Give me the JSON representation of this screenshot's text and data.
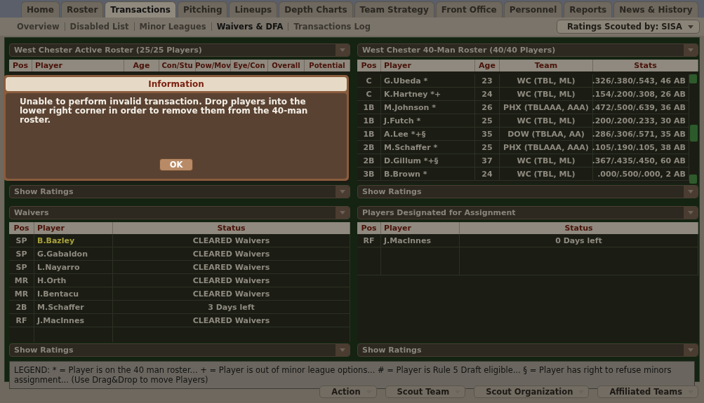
{
  "tabs": [
    {
      "label": "Home",
      "selected": false
    },
    {
      "label": "Roster",
      "selected": false
    },
    {
      "label": "Transactions",
      "selected": true
    },
    {
      "label": "Pitching",
      "selected": false
    },
    {
      "label": "Lineups",
      "selected": false
    },
    {
      "label": "Depth Charts",
      "selected": false
    },
    {
      "label": "Team Strategy",
      "selected": false
    },
    {
      "label": "Front Office",
      "selected": false
    },
    {
      "label": "Personnel",
      "selected": false
    },
    {
      "label": "Reports",
      "selected": false
    },
    {
      "label": "News & History",
      "selected": false
    }
  ],
  "subnav": [
    {
      "label": "Overview",
      "selected": false
    },
    {
      "label": "Disabled List",
      "selected": false
    },
    {
      "label": "Minor Leagues",
      "selected": false
    },
    {
      "label": "Waivers & DFA",
      "selected": true
    },
    {
      "label": "Transactions Log",
      "selected": false
    }
  ],
  "scouted_button": "Ratings Scouted by: SISA",
  "active_roster": {
    "title": "West Chester Active Roster (25/25 Players)",
    "columns": [
      "Pos",
      "Player",
      "Age",
      "Con/Stu",
      "Pow/Mov",
      "Eye/Con",
      "Overall",
      "Potential"
    ],
    "footer": "Show Ratings"
  },
  "forty_man_roster": {
    "title": "West Chester 40-Man Roster (40/40 Players)",
    "columns": [
      "Pos",
      "Player",
      "Age",
      "Team",
      "Stats"
    ],
    "footer": "Show Ratings",
    "rows": [
      {
        "pos": "C",
        "player": "G.Ubeda *",
        "age": "23",
        "team": "WC (TBL, ML)",
        "stats": ".326/.380/.543, 46 AB"
      },
      {
        "pos": "C",
        "player": "K.Hartney *+",
        "age": "24",
        "team": "WC (TBL, ML)",
        "stats": ".154/.200/.308, 26 AB"
      },
      {
        "pos": "1B",
        "player": "M.Johnson *",
        "age": "26",
        "team": "PHX (TBLAAA, AAA)",
        "stats": ".472/.500/.639, 36 AB"
      },
      {
        "pos": "1B",
        "player": "J.Futch *",
        "age": "25",
        "team": "WC (TBL, ML)",
        "stats": ".200/.200/.233, 30 AB"
      },
      {
        "pos": "1B",
        "player": "A.Lee *+§",
        "age": "35",
        "team": "DOW (TBLAA, AA)",
        "stats": ".286/.306/.571, 35 AB"
      },
      {
        "pos": "2B",
        "player": "M.Schaffer *",
        "age": "25",
        "team": "PHX (TBLAAA, AAA)",
        "stats": ".105/.190/.105, 38 AB"
      },
      {
        "pos": "2B",
        "player": "D.Gillum *+§",
        "age": "37",
        "team": "WC (TBL, ML)",
        "stats": ".367/.435/.450, 60 AB"
      },
      {
        "pos": "3B",
        "player": "B.Brown *",
        "age": "24",
        "team": "WC (TBL, ML)",
        "stats": ".000/.500/.000, 2 AB"
      }
    ]
  },
  "waivers": {
    "title": "Waivers",
    "columns": [
      "Pos",
      "Player",
      "Status"
    ],
    "footer": "Show Ratings",
    "rows": [
      {
        "pos": "SP",
        "player": "B.Bazley",
        "status": "CLEARED Waivers",
        "highlighted": true
      },
      {
        "pos": "SP",
        "player": "G.Gabaldon",
        "status": "CLEARED Waivers",
        "highlighted": false
      },
      {
        "pos": "SP",
        "player": "L.Nayarro",
        "status": "CLEARED Waivers",
        "highlighted": false
      },
      {
        "pos": "MR",
        "player": "H.Orth",
        "status": "CLEARED Waivers",
        "highlighted": false
      },
      {
        "pos": "MR",
        "player": "I.Bentacu",
        "status": "CLEARED Waivers",
        "highlighted": false
      },
      {
        "pos": "2B",
        "player": "M.Schaffer",
        "status": "3 Days left",
        "highlighted": false
      },
      {
        "pos": "RF",
        "player": "J.MacInnes",
        "status": "CLEARED Waivers",
        "highlighted": false
      }
    ]
  },
  "dfa": {
    "title": "Players Designated for Assignment",
    "columns": [
      "Pos",
      "Player",
      "Status"
    ],
    "footer": "Show Ratings",
    "rows": [
      {
        "pos": "RF",
        "player": "J.MacInnes",
        "status": "0 Days left",
        "highlighted": false
      }
    ]
  },
  "legend": "LEGEND: * = Player is on the 40 man roster...  + = Player is out of minor league options...  # = Player is Rule 5 Draft eligible...  § = Player has right to refuse minors assignment...    (Use Drag&Drop to move Players)",
  "bottom_buttons": [
    "Action",
    "Scout Team",
    "Scout Organization",
    "Affiliated Teams"
  ],
  "dialog": {
    "title": "Information",
    "message": "Unable to perform invalid transaction. Drop players into the lower right corner in order to remove them from the 40-man roster.",
    "button": "OK"
  }
}
